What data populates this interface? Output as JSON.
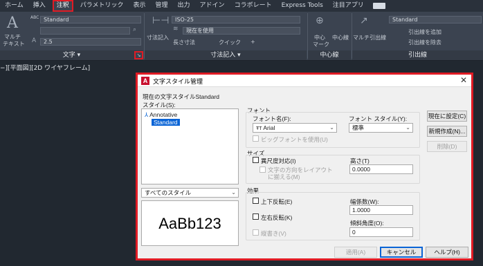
{
  "ribbon": {
    "tabs": [
      "ホーム",
      "挿入",
      "注釈",
      "パラメトリック",
      "表示",
      "管理",
      "出力",
      "アドイン",
      "コラボレート",
      "Express Tools",
      "注目アプリ"
    ],
    "active_tab": "注釈",
    "text_panel": {
      "big_label_line1": "マルチ",
      "big_label_line2": "テキスト",
      "style_combo": "Standard",
      "abc_label": "ABC",
      "height_value": "2.5",
      "title": "文字 ▾"
    },
    "dim_panel": {
      "big_label": "寸法記入",
      "style_combo": "ISO-25",
      "layer_combo": "現在を使用",
      "tolerance_label": "長さ寸法",
      "quick_label": "クイック",
      "continue_label": "+",
      "title": "寸法記入 ▾"
    },
    "center_panel": {
      "label_line1": "中心",
      "label_line2": "マーク",
      "centerline_label": "中心線",
      "title": "中心線"
    },
    "leader_panel": {
      "big_label": "マルチ引出線",
      "style_combo": "Standard",
      "add_label": "引出線を追加",
      "remove_label": "引出線を除去",
      "title": "引出線"
    }
  },
  "viewport": {
    "label": "−][平面図][2D ワイヤフレーム]"
  },
  "dialog": {
    "title": "文字スタイル管理",
    "current_style": "現在の文字スタイルStandard",
    "styles_label": "スタイル(S):",
    "styles": [
      {
        "name": "Annotative",
        "selected": false
      },
      {
        "name": "Standard",
        "selected": true
      }
    ],
    "filter_combo": "すべてのスタイル",
    "preview_text": "AaBb123",
    "font": {
      "group_label": "フォント",
      "font_name_label": "フォント名(F):",
      "font_name_value": "Arial",
      "font_style_label": "フォント スタイル(Y):",
      "font_style_value": "標準",
      "bigfont_label": "ビッグフォントを使用(U)"
    },
    "size": {
      "group_label": "サイズ",
      "annotative_label": "異尺度対応(I)",
      "orientation_label_line1": "文字の方向をレイアウト",
      "orientation_label_line2": "に揃える(M)",
      "height_label": "高さ(T)",
      "height_value": "0.0000"
    },
    "effects": {
      "group_label": "効果",
      "upside_down_label": "上下反転(E)",
      "backwards_label": "左右反転(K)",
      "vertical_label": "縦書き(V)",
      "width_factor_label": "幅係数(W):",
      "width_factor_value": "1.0000",
      "oblique_label": "傾斜角度(O):",
      "oblique_value": "0"
    },
    "buttons": {
      "set_current": "現在に設定(C)",
      "new": "新規作成(N)...",
      "delete": "削除(D)",
      "apply": "適用(A)",
      "cancel": "キャンセル",
      "help": "ヘルプ(H)"
    }
  },
  "colors": {
    "highlight": "#e01b24",
    "selection": "#0a64d6",
    "ribbon_bg": "#3b4350",
    "canvas_bg": "#212830"
  }
}
